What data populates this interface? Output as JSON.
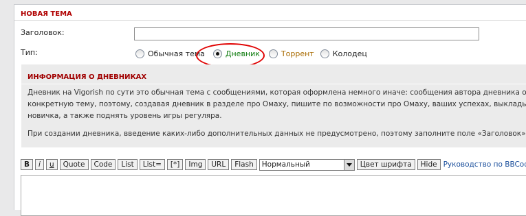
{
  "section": {
    "title": "НОВАЯ ТЕМА"
  },
  "fields": {
    "title_label": "Заголовок:",
    "title_value": "",
    "type_label": "Тип:"
  },
  "topic_types": [
    {
      "label": "Обычная тема",
      "checked": false,
      "color": "#222222"
    },
    {
      "label": "Дневник",
      "checked": true,
      "color": "#0b7a0b"
    },
    {
      "label": "Торрент",
      "checked": false,
      "color": "#a86a00"
    },
    {
      "label": "Колодец",
      "checked": false,
      "color": "#222222"
    }
  ],
  "info": {
    "title": "ИНФОРМАЦИЯ О ДНЕВНИКАХ",
    "paragraph1_lines": [
      "Дневник на Vigorish по сути это обычная тема с сообщениями, которая оформлена немного иначе: сообщения автора дневника отмечены зел",
      "конкретную тему, поэтому, создавая дневник в разделе про Омаху, пишите по возможности про Омаху, ваших успехах, выкладывайте стат",
      "новичка, а также поднять уровень игры регуляра."
    ],
    "paragraph2": "При создании дневника, введение каких-либо дополнительных данных не предусмотрено, поэтому заполните поле «Заголовок», напишите"
  },
  "toolbar": {
    "buttons": [
      "B",
      "i",
      "u",
      "Quote",
      "Code",
      "List",
      "List=",
      "[*]",
      "Img",
      "URL",
      "Flash"
    ],
    "size_select": "Нормальный",
    "font_color": "Цвет шрифта",
    "hide": "Hide",
    "bbcode_help": "Руководство по BBCode"
  },
  "colors": {
    "accent_red": "#b00000",
    "annotation_ring": "#e00000",
    "link_blue": "#1b4f9c"
  }
}
